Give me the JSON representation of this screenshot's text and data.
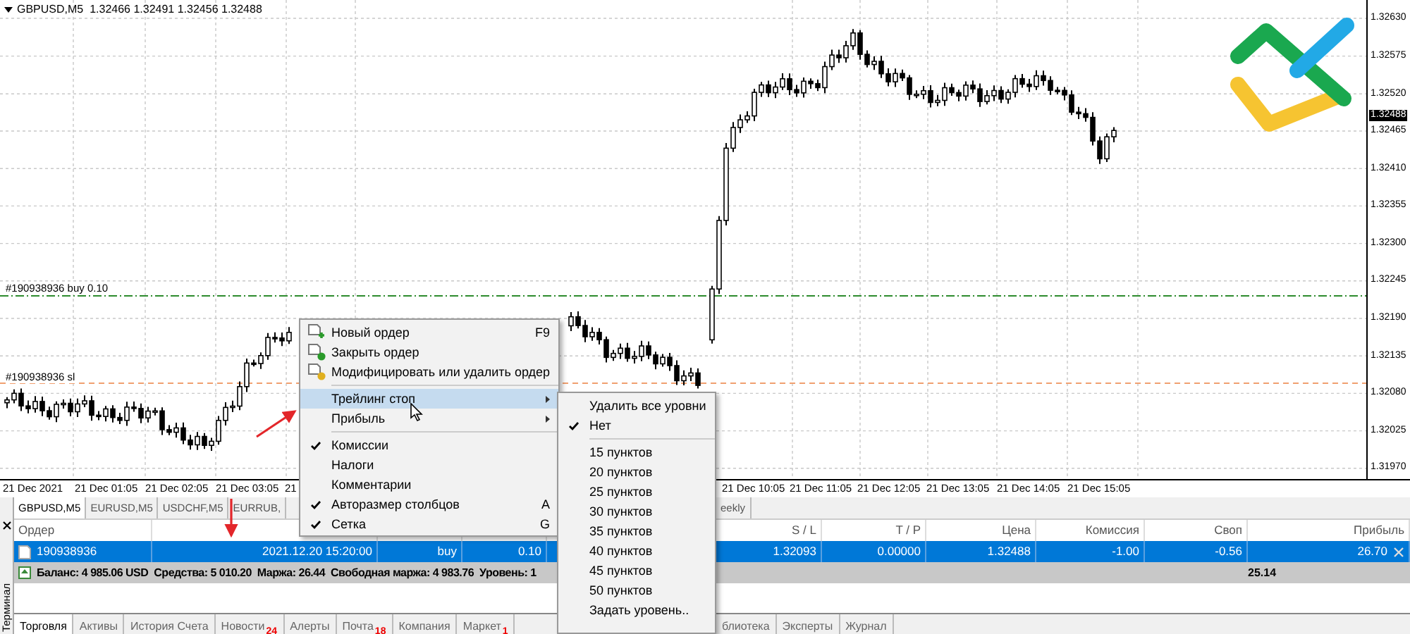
{
  "chart": {
    "symbol_info": "GBPUSD,M5  1.32466 1.32491 1.32456 1.32488",
    "price_labels": [
      "1.32630",
      "1.32575",
      "1.32520",
      "1.32465",
      "1.32410",
      "1.32355",
      "1.32300",
      "1.32245",
      "1.32190",
      "1.32135",
      "1.32080",
      "1.32025",
      "1.31970"
    ],
    "current_price": "1.32488",
    "time_labels": [
      "21 Dec 2021",
      "21 Dec 01:05",
      "21 Dec 02:05",
      "21 Dec 03:05",
      "21",
      "21 Dec 10:05",
      "21 Dec 11:05",
      "21 Dec 12:05",
      "21 Dec 13:05",
      "21 Dec 14:05",
      "21 Dec 15:05"
    ],
    "order_line_label": "#190938936 buy 0.10",
    "sl_line_label": "#190938936 sl"
  },
  "context_menu": {
    "items": [
      {
        "kind": "command",
        "label": "Новый ордер",
        "shortcut": "F9",
        "selected": false
      },
      {
        "kind": "command",
        "label": "Закрыть ордер",
        "selected": false
      },
      {
        "kind": "command",
        "label": "Модифицировать или удалить ордер",
        "selected": false
      },
      {
        "kind": "separator"
      },
      {
        "kind": "submenu",
        "label": "Трейлинг стоп",
        "selected": true
      },
      {
        "kind": "submenu",
        "label": "Прибыль",
        "selected": false
      },
      {
        "kind": "separator"
      },
      {
        "kind": "check",
        "label": "Комиссии",
        "checked": true,
        "selected": false
      },
      {
        "kind": "check",
        "label": "Налоги",
        "checked": false,
        "selected": false
      },
      {
        "kind": "check",
        "label": "Комментарии",
        "checked": false,
        "selected": false
      },
      {
        "kind": "check",
        "label": "Авторазмер столбцов",
        "shortcut": "A",
        "checked": true,
        "selected": false
      },
      {
        "kind": "check",
        "label": "Сетка",
        "shortcut": "G",
        "checked": true,
        "selected": false
      }
    ]
  },
  "submenu": {
    "items": [
      {
        "kind": "command",
        "label": "Удалить все уровни",
        "selected": false
      },
      {
        "kind": "check",
        "label": "Нет",
        "checked": true,
        "selected": false
      },
      {
        "kind": "separator"
      },
      {
        "kind": "check",
        "label": "15 пунктов",
        "checked": false,
        "selected": false
      },
      {
        "kind": "check",
        "label": "20 пунктов",
        "checked": false,
        "selected": false
      },
      {
        "kind": "check",
        "label": "25 пунктов",
        "checked": false,
        "selected": false
      },
      {
        "kind": "check",
        "label": "30 пунктов",
        "checked": false,
        "selected": false
      },
      {
        "kind": "check",
        "label": "35 пунктов",
        "checked": false,
        "selected": false
      },
      {
        "kind": "check",
        "label": "40 пунктов",
        "checked": false,
        "selected": false
      },
      {
        "kind": "check",
        "label": "45 пунктов",
        "checked": false,
        "selected": false
      },
      {
        "kind": "check",
        "label": "50 пунктов",
        "checked": false,
        "selected": false
      },
      {
        "kind": "command",
        "label": "Задать уровень..",
        "selected": false
      }
    ]
  },
  "terminal": {
    "title": "Терминал",
    "symbol_tabs_left": [
      {
        "label": "GBPUSD,M5",
        "selected": true
      },
      {
        "label": "EURUSD,M5",
        "selected": false
      },
      {
        "label": "USDCHF,M5",
        "selected": false
      },
      {
        "label": "EURRUB,",
        "selected": false
      }
    ],
    "symbol_tabs_right": [
      {
        "label": "eekly",
        "selected": false
      }
    ],
    "columns": [
      "Ордер",
      "S / L",
      "T / P",
      "Цена",
      "Комиссия",
      "Своп",
      "Прибыль"
    ],
    "rows": [
      {
        "order": "190938936",
        "time": "2021.12.20 15:20:00",
        "type": "buy",
        "volume": "0.10",
        "sl": "1.32093",
        "tp": "0.00000",
        "price": "1.32488",
        "commission": "-1.00",
        "swap": "-0.56",
        "profit": "26.70",
        "selected": true
      }
    ],
    "balance_items": [
      "Баланс: 4 985.06 USD",
      "Средства: 5 010.20",
      "Маржа: 26.44",
      "Свободная маржа: 4 983.76",
      "Уровень: 1"
    ],
    "total_profit": "25.14",
    "tabs_left": [
      {
        "label": "Торговля",
        "selected": true
      },
      {
        "label": "Активы",
        "selected": false
      },
      {
        "label": "История Счета",
        "selected": false
      },
      {
        "label": "Новости",
        "badge": "24",
        "selected": false
      },
      {
        "label": "Алерты",
        "selected": false
      },
      {
        "label": "Почта",
        "badge": "18",
        "selected": false
      },
      {
        "label": "Компания",
        "selected": false
      },
      {
        "label": "Маркет",
        "badge": "1",
        "selected": false
      }
    ],
    "tabs_right": [
      {
        "label": "блиотека",
        "selected": false
      },
      {
        "label": "Эксперты",
        "selected": false
      },
      {
        "label": "Журнал",
        "selected": false
      }
    ]
  }
}
